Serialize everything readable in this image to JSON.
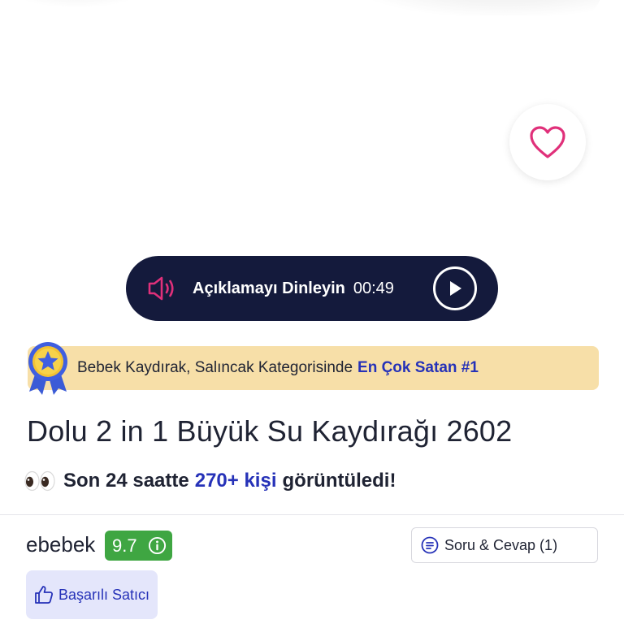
{
  "audio": {
    "label": "Açıklamayı Dinleyin",
    "duration": "00:49",
    "icons": {
      "speaker": "speaker-icon",
      "play": "play-icon"
    }
  },
  "favorite": {
    "icon": "heart-icon",
    "color": "#e0307a"
  },
  "bestseller": {
    "category_text": "Bebek Kaydırak, Salıncak Kategorisinde",
    "rank_text": "En Çok Satan #1",
    "icon": "medal-icon"
  },
  "product": {
    "title": "Dolu 2 in 1 Büyük Su Kaydırağı 2602"
  },
  "views": {
    "emoji": "👀",
    "prefix": "Son 24 saatte",
    "count": "270+ kişi",
    "suffix": "görüntüledi!"
  },
  "seller": {
    "name": "ebebek",
    "score": "9.7",
    "badge_label": "Başarılı Satıcı"
  },
  "qa": {
    "label": "Soru & Cevap (1)"
  },
  "colors": {
    "accent": "#2632b8",
    "pill_bg": "#141a3c",
    "banner_bg": "#f7dfa8",
    "score_green": "#3fa642",
    "pink": "#e0307a"
  }
}
